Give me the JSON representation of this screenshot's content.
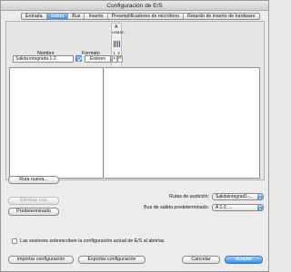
{
  "window": {
    "title": "Configuración de E/S"
  },
  "tabs": [
    {
      "label": "Entrada"
    },
    {
      "label": "Salida"
    },
    {
      "label": "Bus"
    },
    {
      "label": "Inserto"
    },
    {
      "label": "Preamplificadores de micrófono"
    },
    {
      "label": "Retardo de inserto de hardware"
    }
  ],
  "columns": {
    "name": "Nombre",
    "format": "Formato"
  },
  "grid_header": {
    "letter": "A",
    "vertical_text": "USBAC",
    "channels": [
      "1",
      "2"
    ]
  },
  "output_row": {
    "name": "Salida integrada 1-2",
    "format": "Estéreo",
    "left": "L",
    "right": "R"
  },
  "buttons": {
    "new_path": "Ruta nueva...",
    "delete_path": "Eliminar ruta",
    "default": "Predeterminado",
    "import": "Importar configuración",
    "export": "Exportar configuración",
    "cancel": "Cancelar",
    "ok": "Aceptar"
  },
  "audition": {
    "label": "Rutas de audición:",
    "value": "SalidaIntegrad1-..."
  },
  "default_bus": {
    "label": "Bus de salida predeterminado:",
    "value": "A 1-2, ..."
  },
  "sessions_checkbox": {
    "label": "Las sesiones sobrescriben la configuración actual de E/S al abrirlas",
    "checked": false
  }
}
